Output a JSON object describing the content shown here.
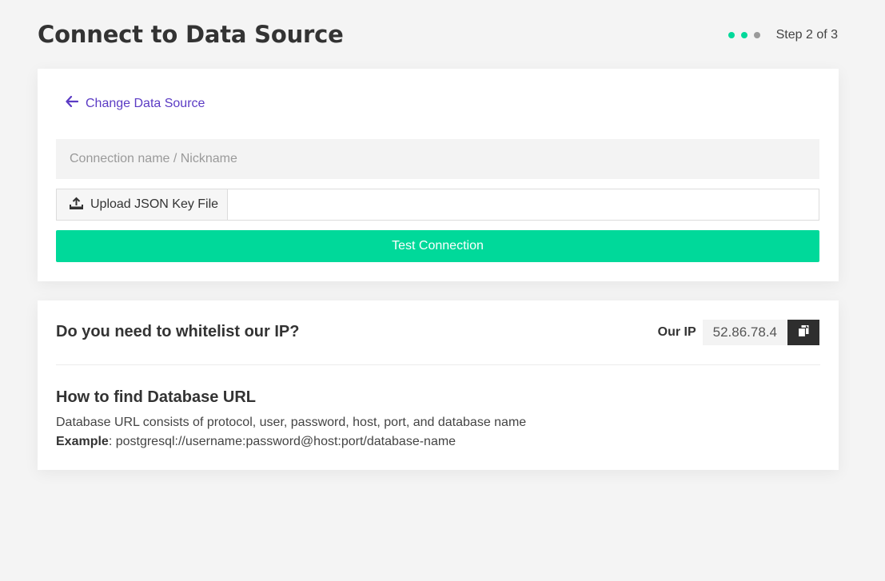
{
  "header": {
    "title": "Connect to Data Source",
    "step_label": "Step 2 of 3",
    "step_dots": [
      "#00d99a",
      "#00d99a",
      "#9a9a9a"
    ]
  },
  "connect": {
    "back_label": "Change Data Source",
    "name_placeholder": "Connection name / Nickname",
    "upload_label": "Upload JSON Key File",
    "test_label": "Test Connection"
  },
  "whitelist": {
    "title": "Do you need to whitelist our IP?",
    "ip_label": "Our IP",
    "ip_value": "52.86.78.4",
    "copy_icon": "copy-icon"
  },
  "help": {
    "title": "How to find Database URL",
    "description": "Database URL consists of protocol, user, password, host, port, and database name",
    "example_label": "Example",
    "example_value": ": postgresql://username:password@host:port/database-name"
  },
  "colors": {
    "accent": "#00d99a",
    "link": "#5b3bc4",
    "dark_button": "#2e2e2e"
  }
}
